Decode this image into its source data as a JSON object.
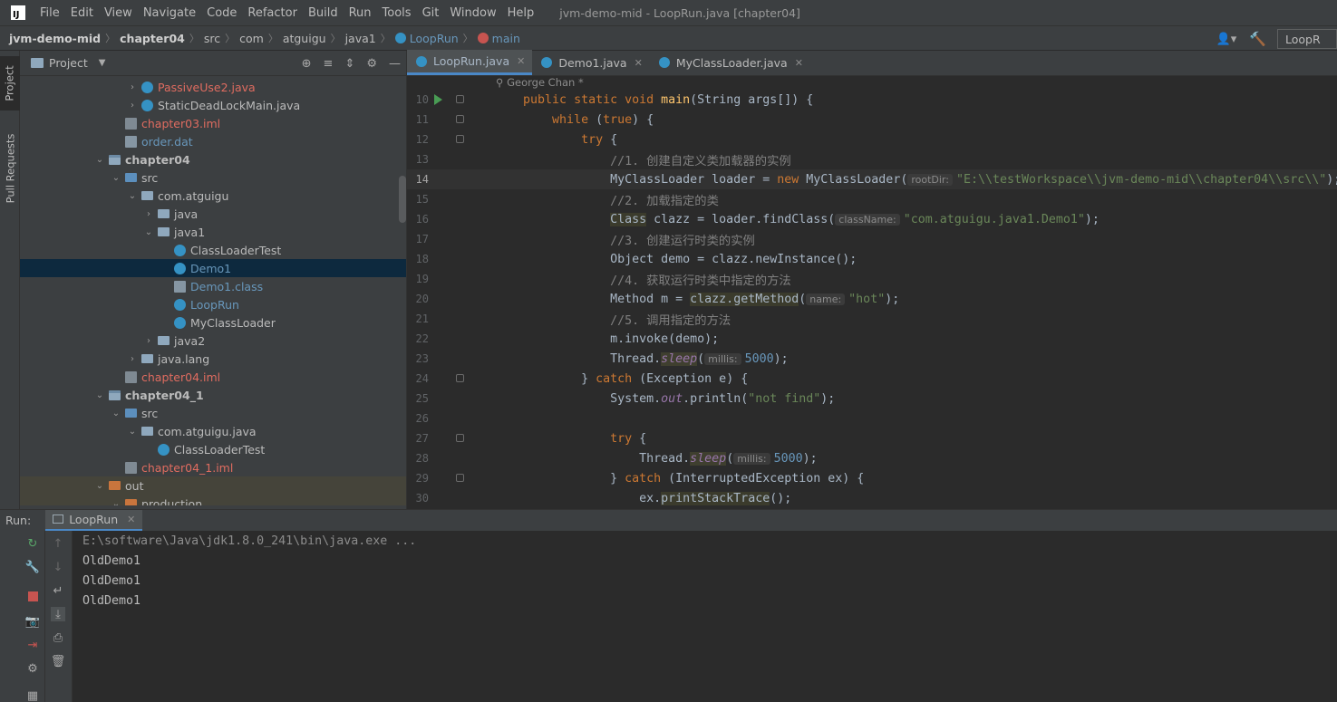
{
  "app": {
    "logo": "IJ",
    "window_title": "jvm-demo-mid - LoopRun.java [chapter04]"
  },
  "menu": [
    "File",
    "Edit",
    "View",
    "Navigate",
    "Code",
    "Refactor",
    "Build",
    "Run",
    "Tools",
    "Git",
    "Window",
    "Help"
  ],
  "breadcrumb": {
    "project": "jvm-demo-mid",
    "module": "chapter04",
    "parts": [
      "src",
      "com",
      "atguigu",
      "java1"
    ],
    "class": "LoopRun",
    "method": "main"
  },
  "run_config": {
    "label": "LoopR"
  },
  "left_tabs": {
    "project": "Project",
    "pull_requests": "Pull Requests"
  },
  "project_panel": {
    "title": "Project",
    "tree": [
      {
        "label": "PassiveUse2.java",
        "color": "red",
        "icon": "class",
        "indent": 2,
        "arrow": "right"
      },
      {
        "label": "StaticDeadLockMain.java",
        "color": "norm",
        "icon": "class",
        "indent": 2,
        "arrow": "right"
      },
      {
        "label": "chapter03.iml",
        "color": "red",
        "icon": "iml",
        "indent": 1,
        "arrow": ""
      },
      {
        "label": "order.dat",
        "color": "blue",
        "icon": "file",
        "indent": 1,
        "arrow": ""
      },
      {
        "label": "chapter04",
        "color": "norm",
        "icon": "module",
        "indent": 0,
        "arrow": "down",
        "bold": true
      },
      {
        "label": "src",
        "color": "norm",
        "icon": "src",
        "indent": 1,
        "arrow": "down"
      },
      {
        "label": "com.atguigu",
        "color": "norm",
        "icon": "folder",
        "indent": 2,
        "arrow": "down"
      },
      {
        "label": "java",
        "color": "norm",
        "icon": "folder",
        "indent": 3,
        "arrow": "right"
      },
      {
        "label": "java1",
        "color": "norm",
        "icon": "folder",
        "indent": 3,
        "arrow": "down"
      },
      {
        "label": "ClassLoaderTest",
        "color": "norm",
        "icon": "class",
        "indent": 4,
        "arrow": ""
      },
      {
        "label": "Demo1",
        "color": "blue",
        "icon": "class",
        "indent": 4,
        "arrow": "",
        "selected": true
      },
      {
        "label": "Demo1.class",
        "color": "blue",
        "icon": "file",
        "indent": 4,
        "arrow": ""
      },
      {
        "label": "LoopRun",
        "color": "blue",
        "icon": "class",
        "indent": 4,
        "arrow": ""
      },
      {
        "label": "MyClassLoader",
        "color": "norm",
        "icon": "class",
        "indent": 4,
        "arrow": ""
      },
      {
        "label": "java2",
        "color": "norm",
        "icon": "folder",
        "indent": 3,
        "arrow": "right"
      },
      {
        "label": "java.lang",
        "color": "norm",
        "icon": "folder",
        "indent": 2,
        "arrow": "right"
      },
      {
        "label": "chapter04.iml",
        "color": "red",
        "icon": "iml",
        "indent": 1,
        "arrow": ""
      },
      {
        "label": "chapter04_1",
        "color": "norm",
        "icon": "module",
        "indent": 0,
        "arrow": "down",
        "bold": true
      },
      {
        "label": "src",
        "color": "norm",
        "icon": "src",
        "indent": 1,
        "arrow": "down"
      },
      {
        "label": "com.atguigu.java",
        "color": "norm",
        "icon": "folder",
        "indent": 2,
        "arrow": "down"
      },
      {
        "label": "ClassLoaderTest",
        "color": "norm",
        "icon": "class",
        "indent": 3,
        "arrow": ""
      },
      {
        "label": "chapter04_1.iml",
        "color": "red",
        "icon": "iml",
        "indent": 1,
        "arrow": ""
      },
      {
        "label": "out",
        "color": "norm",
        "icon": "out",
        "indent": 0,
        "arrow": "down",
        "highlight": true
      },
      {
        "label": "production",
        "color": "norm",
        "icon": "out",
        "indent": 1,
        "arrow": "down",
        "highlight": true
      }
    ]
  },
  "editor": {
    "tabs": [
      {
        "label": "LoopRun.java",
        "active": true
      },
      {
        "label": "Demo1.java",
        "active": false
      },
      {
        "label": "MyClassLoader.java",
        "active": false
      }
    ],
    "author": "George Chan *",
    "current_line": "14",
    "lines": [
      {
        "n": "10",
        "run": true,
        "fold": true,
        "segs": [
          [
            "txt",
            "    "
          ],
          [
            "kw",
            "public static void "
          ],
          [
            "fn",
            "main"
          ],
          [
            "txt",
            "(String args[]) {"
          ]
        ]
      },
      {
        "n": "11",
        "fold": true,
        "segs": [
          [
            "txt",
            "        "
          ],
          [
            "kw",
            "while "
          ],
          [
            "txt",
            "("
          ],
          [
            "kw",
            "true"
          ],
          [
            "txt",
            ") {"
          ]
        ]
      },
      {
        "n": "12",
        "fold": true,
        "segs": [
          [
            "txt",
            "            "
          ],
          [
            "kw",
            "try "
          ],
          [
            "txt",
            "{"
          ]
        ]
      },
      {
        "n": "13",
        "segs": [
          [
            "txt",
            "                "
          ],
          [
            "cm",
            "//1. 创建自定义类加载器的实例"
          ]
        ]
      },
      {
        "n": "14",
        "cur": true,
        "segs": [
          [
            "txt",
            "                MyClassLoader loader = "
          ],
          [
            "kw",
            "new "
          ],
          [
            "txt",
            "MyClassLoader("
          ],
          [
            "hint",
            "rootDir:"
          ],
          [
            "str",
            "\"E:\\\\testWorkspace\\\\jvm-demo-mid\\\\chapter04\\\\src\\\\\""
          ],
          [
            "txt",
            ");"
          ]
        ]
      },
      {
        "n": "15",
        "segs": [
          [
            "txt",
            "                "
          ],
          [
            "cm",
            "//2. 加载指定的类"
          ]
        ]
      },
      {
        "n": "16",
        "segs": [
          [
            "txt",
            "                "
          ],
          [
            "clsbg",
            "Class"
          ],
          [
            "txt",
            " clazz = loader.findClass("
          ],
          [
            "hint",
            "className:"
          ],
          [
            "str",
            "\"com.atguigu.java1.Demo1\""
          ],
          [
            "txt",
            ");"
          ]
        ]
      },
      {
        "n": "17",
        "segs": [
          [
            "txt",
            "                "
          ],
          [
            "cm",
            "//3. 创建运行时类的实例"
          ]
        ]
      },
      {
        "n": "18",
        "segs": [
          [
            "txt",
            "                Object demo = clazz.newInstance();"
          ]
        ]
      },
      {
        "n": "19",
        "segs": [
          [
            "txt",
            "                "
          ],
          [
            "cm",
            "//4. 获取运行时类中指定的方法"
          ]
        ]
      },
      {
        "n": "20",
        "segs": [
          [
            "txt",
            "                Method m = "
          ],
          [
            "clsbg",
            "clazz.getMethod"
          ],
          [
            "txt",
            "("
          ],
          [
            "hint",
            "name:"
          ],
          [
            "str",
            "\"hot\""
          ],
          [
            "txt",
            ");"
          ]
        ]
      },
      {
        "n": "21",
        "segs": [
          [
            "txt",
            "                "
          ],
          [
            "cm",
            "//5. 调用指定的方法"
          ]
        ]
      },
      {
        "n": "22",
        "segs": [
          [
            "txt",
            "                m.invoke(demo);"
          ]
        ]
      },
      {
        "n": "23",
        "segs": [
          [
            "txt",
            "                Thread."
          ],
          [
            "sleep",
            "sleep"
          ],
          [
            "txt",
            "("
          ],
          [
            "hint",
            "millis:"
          ],
          [
            "num",
            "5000"
          ],
          [
            "txt",
            ");"
          ]
        ]
      },
      {
        "n": "24",
        "fold": true,
        "segs": [
          [
            "txt",
            "            } "
          ],
          [
            "kw",
            "catch "
          ],
          [
            "txt",
            "(Exception e) {"
          ]
        ]
      },
      {
        "n": "25",
        "segs": [
          [
            "txt",
            "                System."
          ],
          [
            "it",
            "out"
          ],
          [
            "txt",
            ".println("
          ],
          [
            "str",
            "\"not find\""
          ],
          [
            "txt",
            ");"
          ]
        ]
      },
      {
        "n": "26",
        "segs": [
          [
            "txt",
            ""
          ]
        ]
      },
      {
        "n": "27",
        "fold": true,
        "segs": [
          [
            "txt",
            "                "
          ],
          [
            "kw",
            "try "
          ],
          [
            "txt",
            "{"
          ]
        ]
      },
      {
        "n": "28",
        "segs": [
          [
            "txt",
            "                    Thread."
          ],
          [
            "sleep",
            "sleep"
          ],
          [
            "txt",
            "("
          ],
          [
            "hint",
            "millis:"
          ],
          [
            "num",
            "5000"
          ],
          [
            "txt",
            ");"
          ]
        ]
      },
      {
        "n": "29",
        "fold": true,
        "segs": [
          [
            "txt",
            "                } "
          ],
          [
            "kw",
            "catch "
          ],
          [
            "txt",
            "(InterruptedException ex) {"
          ]
        ]
      },
      {
        "n": "30",
        "segs": [
          [
            "txt",
            "                    ex."
          ],
          [
            "clsbg",
            "printStackTrace"
          ],
          [
            "txt",
            "();"
          ]
        ]
      }
    ]
  },
  "run_panel": {
    "label": "Run:",
    "tab": "LoopRun",
    "console": [
      {
        "text": "E:\\software\\Java\\jdk1.8.0_241\\bin\\java.exe ...",
        "kind": "cmd"
      },
      {
        "text": "OldDemo1",
        "kind": "out"
      },
      {
        "text": "OldDemo1",
        "kind": "out"
      },
      {
        "text": "OldDemo1",
        "kind": "out"
      }
    ]
  }
}
